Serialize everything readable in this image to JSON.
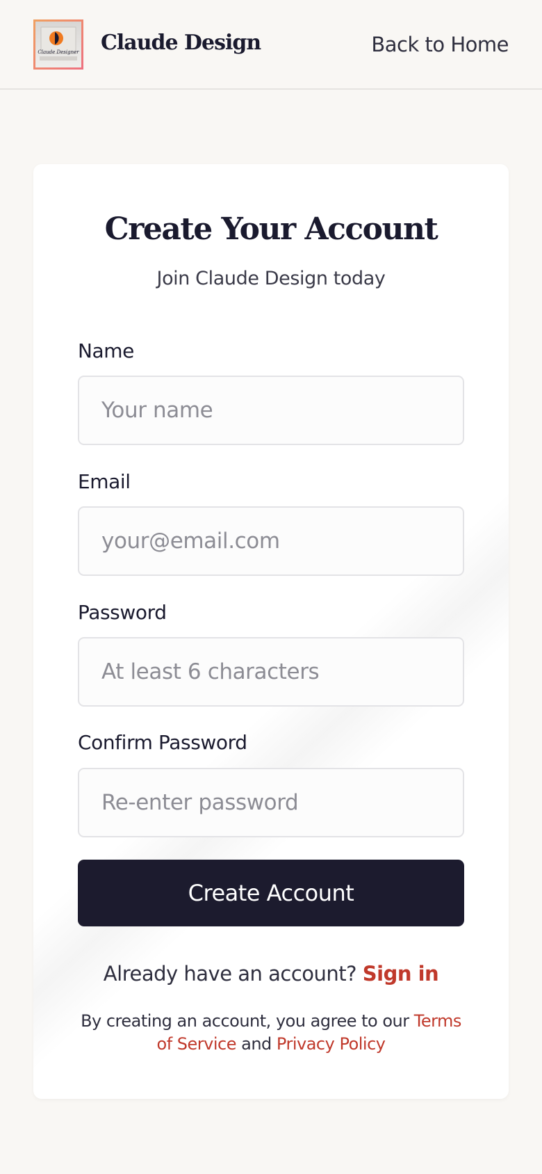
{
  "header": {
    "logo_text": "Claude Designer",
    "brand": "Claude Design",
    "back_link": "Back to Home"
  },
  "card": {
    "title": "Create Your Account",
    "subtitle": "Join Claude Design today"
  },
  "form": {
    "name": {
      "label": "Name",
      "placeholder": "Your name",
      "value": ""
    },
    "email": {
      "label": "Email",
      "placeholder": "your@email.com",
      "value": ""
    },
    "password": {
      "label": "Password",
      "placeholder": "At least 6 characters",
      "value": ""
    },
    "confirm": {
      "label": "Confirm Password",
      "placeholder": "Re-enter password",
      "value": ""
    },
    "submit_label": "Create Account"
  },
  "footer": {
    "signin_prompt": "Already have an account?",
    "signin_link": "Sign in",
    "legal_prefix": "By creating an account, you agree to our",
    "terms_link": "Terms of Service",
    "legal_and": "and",
    "privacy_link": "Privacy Policy"
  },
  "colors": {
    "background": "#f9f7f4",
    "primary_button": "#1c1b2e",
    "link_accent": "#c0392b",
    "text": "#1a1a2e"
  },
  "icons": {
    "logo": "claude-designer-logo-icon"
  }
}
